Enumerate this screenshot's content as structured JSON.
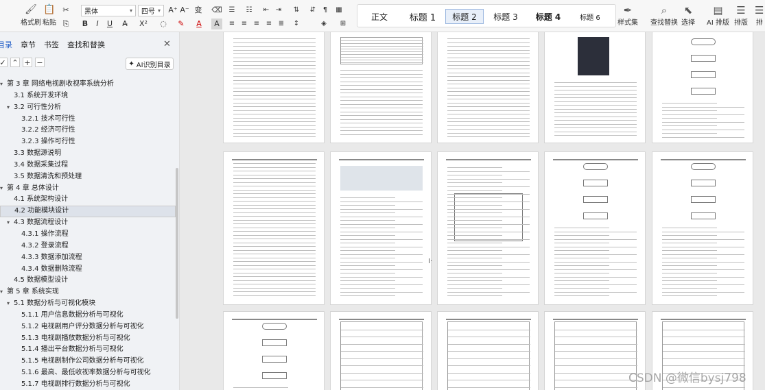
{
  "ribbon": {
    "format_painter": "格式刷",
    "paste": "粘贴",
    "font_name": "黑体",
    "font_size": "四号",
    "styles": [
      {
        "label": "正文"
      },
      {
        "label": "标题 1"
      },
      {
        "label": "标题 2"
      },
      {
        "label": "标题 3"
      },
      {
        "label": "标题 4"
      },
      {
        "label": "标题 6"
      }
    ],
    "style_set": "样式集",
    "find_replace": "查找替换",
    "select": "选择",
    "ai_layout": "AI 排版",
    "layout": "排版",
    "more": "排"
  },
  "nav": {
    "tabs": [
      "目录",
      "章节",
      "书签",
      "查找和替换"
    ],
    "ai_toc": "AI识别目录",
    "items": [
      {
        "label": "第 3 章  网络电视剧收视率系统分析",
        "level": 1,
        "arrow": "▾"
      },
      {
        "label": "3.1  系统开发环境",
        "level": 2
      },
      {
        "label": "3.2  可行性分析",
        "level": 2,
        "arrow": "▾"
      },
      {
        "label": "3.2.1  技术可行性",
        "level": 3
      },
      {
        "label": "3.2.2  经济可行性",
        "level": 3
      },
      {
        "label": "3.2.3  操作可行性",
        "level": 3
      },
      {
        "label": "3.3  数据源说明",
        "level": 2
      },
      {
        "label": "3.4  数据采集过程",
        "level": 2
      },
      {
        "label": "3.5  数据清洗和预处理",
        "level": 2
      },
      {
        "label": "第 4 章  总体设计",
        "level": 1,
        "arrow": "▾"
      },
      {
        "label": "4.1  系统架构设计",
        "level": 2
      },
      {
        "label": "4.2  功能模块设计",
        "level": 2,
        "selected": true
      },
      {
        "label": "4.3  数据流程设计",
        "level": 2,
        "arrow": "▾"
      },
      {
        "label": "4.3.1  操作流程",
        "level": 3
      },
      {
        "label": "4.3.2  登录流程",
        "level": 3
      },
      {
        "label": "4.3.3  数据添加流程",
        "level": 3
      },
      {
        "label": "4.3.4  数据删除流程",
        "level": 3
      },
      {
        "label": "4.5  数据模型设计",
        "level": 2
      },
      {
        "label": "第 5 章  系统实现",
        "level": 1,
        "arrow": "▾"
      },
      {
        "label": "5.1  数据分析与可视化模块",
        "level": 2,
        "arrow": "▾"
      },
      {
        "label": "5.1.1  用户信息数据分析与可视化",
        "level": 3
      },
      {
        "label": "5.1.2  电视剧用户评分数据分析与可视化",
        "level": 3
      },
      {
        "label": "5.1.3  电视剧播放数据分析与可视化",
        "level": 3
      },
      {
        "label": "5.1.4  播出平台数据分析与可视化",
        "level": 3
      },
      {
        "label": "5.1.5  电视剧制作公司数据分析与可视化",
        "level": 3
      },
      {
        "label": "5.1.6  最高、最低收视率数据分析与可视化",
        "level": 3
      },
      {
        "label": "5.1.7  电视剧排行数据分析与可视化",
        "level": 3
      }
    ]
  },
  "watermark": "CSDN @微信bysj798"
}
